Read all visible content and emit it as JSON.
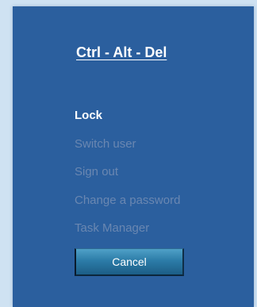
{
  "dialog": {
    "title": "Ctrl - Alt - Del",
    "menu": [
      {
        "label": "Lock",
        "active": true
      },
      {
        "label": "Switch user",
        "active": false
      },
      {
        "label": "Sign out",
        "active": false
      },
      {
        "label": "Change a password",
        "active": false
      },
      {
        "label": "Task Manager",
        "active": false
      }
    ],
    "cancel_label": "Cancel"
  },
  "colors": {
    "page_background": "#cfe2f2",
    "panel_background": "#2b5f9e",
    "active_text": "#ffffff",
    "inactive_text": "#6a87b1",
    "button_top": "#4fa0c7",
    "button_bottom": "#1c5d86"
  }
}
